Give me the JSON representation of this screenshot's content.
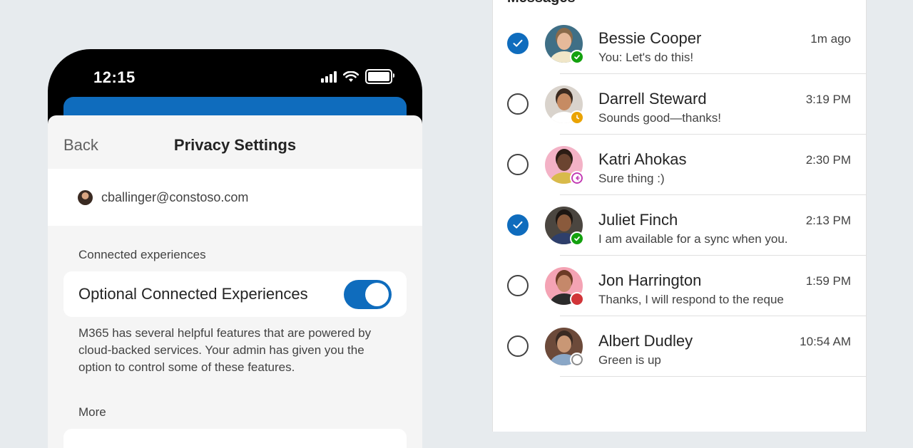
{
  "phone": {
    "status_time": "12:15",
    "header": {
      "back_label": "Back",
      "title": "Privacy Settings"
    },
    "account_email": "cballinger@constoso.com",
    "connected_section_label": "Connected experiences",
    "optional_label": "Optional Connected Experiences",
    "toggle_on": true,
    "description": "M365 has several helpful features that are powered by cloud-backed services. Your admin has given you the option to control some of these features.",
    "more_label": "More"
  },
  "messages": {
    "title": "Messages",
    "items": [
      {
        "name": "Bessie Cooper",
        "time": "1m ago",
        "preview": "You: Let's do this!",
        "checked": true,
        "presence": "available"
      },
      {
        "name": "Darrell Steward",
        "time": "3:19 PM",
        "preview": "Sounds good—thanks!",
        "checked": false,
        "presence": "away"
      },
      {
        "name": "Katri Ahokas",
        "time": "2:30 PM",
        "preview": "Sure thing :)",
        "checked": false,
        "presence": "out-of-office"
      },
      {
        "name": "Juliet Finch",
        "time": "2:13 PM",
        "preview": "I am available for a sync when you.",
        "checked": true,
        "presence": "available"
      },
      {
        "name": "Jon Harrington",
        "time": "1:59 PM",
        "preview": "Thanks, I will respond to the reque",
        "checked": false,
        "presence": "busy"
      },
      {
        "name": "Albert Dudley",
        "time": "10:54 AM",
        "preview": "Green is up",
        "checked": false,
        "presence": "offline"
      }
    ]
  },
  "colors": {
    "accent": "#0f6cbd",
    "available": "#13a10e",
    "away": "#eaa300",
    "out_of_office": "#c239b3",
    "busy": "#d13438",
    "offline": "#8a8a8a"
  }
}
